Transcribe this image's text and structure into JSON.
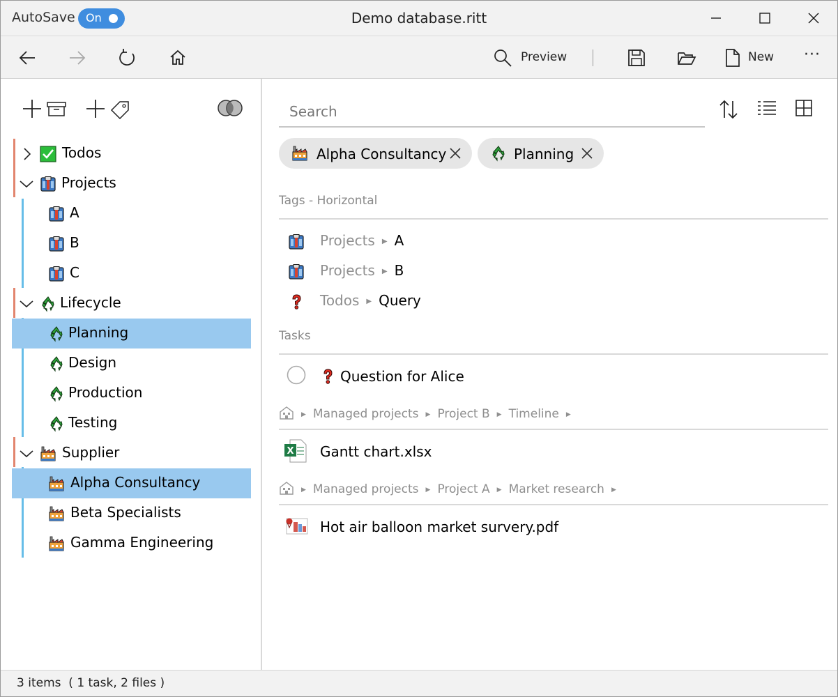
{
  "titlebar": {
    "autosave_label": "AutoSave",
    "autosave_state": "On",
    "title": "Demo database.ritt",
    "accent": "#3f8ddf"
  },
  "toolbar": {
    "back_icon": "arrow-left-icon",
    "forward_icon": "arrow-right-icon",
    "refresh_icon": "refresh-icon",
    "home_icon": "home-icon",
    "preview_label": "Preview",
    "save_icon": "save-icon",
    "open_icon": "folder-open-icon",
    "new_label": "New",
    "more_label": "···"
  },
  "left_pane": {
    "actions": [
      "add-container-icon",
      "add-tag-icon",
      "intersect-icon"
    ],
    "tree": [
      {
        "label": "Todos",
        "icon": "checkbox-icon",
        "expanded": false
      },
      {
        "label": "Projects",
        "icon": "project-icon",
        "expanded": true
      },
      {
        "label": "A",
        "icon": "project-icon"
      },
      {
        "label": "B",
        "icon": "project-icon"
      },
      {
        "label": "C",
        "icon": "project-icon"
      },
      {
        "label": "Lifecycle",
        "icon": "recycle-icon",
        "expanded": true
      },
      {
        "label": "Planning",
        "icon": "recycle-icon",
        "selected": true
      },
      {
        "label": "Design",
        "icon": "recycle-icon"
      },
      {
        "label": "Production",
        "icon": "recycle-icon"
      },
      {
        "label": "Testing",
        "icon": "recycle-icon"
      },
      {
        "label": "Supplier",
        "icon": "factory-icon",
        "expanded": true
      },
      {
        "label": "Alpha Consultancy",
        "icon": "factory-icon",
        "selected": true
      },
      {
        "label": "Beta Specialists",
        "icon": "factory-icon"
      },
      {
        "label": "Gamma Engineering",
        "icon": "factory-icon"
      }
    ],
    "selection_color": "#99c9ef"
  },
  "right_pane": {
    "search_placeholder": "Search",
    "filters": [
      {
        "label": "Alpha Consultancy",
        "icon": "factory-icon"
      },
      {
        "label": "Planning",
        "icon": "recycle-icon"
      }
    ],
    "tags_section": "Tags - Horizontal",
    "tag_rows": [
      {
        "parent": "Projects",
        "child": "A",
        "icon": "project-icon"
      },
      {
        "parent": "Projects",
        "child": "B",
        "icon": "project-icon"
      },
      {
        "parent": "Todos",
        "child": "Query",
        "icon": "question-icon"
      }
    ],
    "tasks_section": "Tasks",
    "items": [
      {
        "title": "Question for Alice",
        "icon": "question-icon",
        "kind": "task",
        "path": [
          "Managed projects",
          "Project B",
          "Timeline"
        ]
      },
      {
        "title": "Gantt chart.xlsx",
        "icon": "excel-icon",
        "kind": "file",
        "path": [
          "Managed projects",
          "Project A",
          "Market research"
        ]
      },
      {
        "title": "Hot air balloon market survery.pdf",
        "icon": "pdf-icon",
        "kind": "file"
      }
    ]
  },
  "status": {
    "text": "3 items  ( 1 task, 2 files )"
  }
}
